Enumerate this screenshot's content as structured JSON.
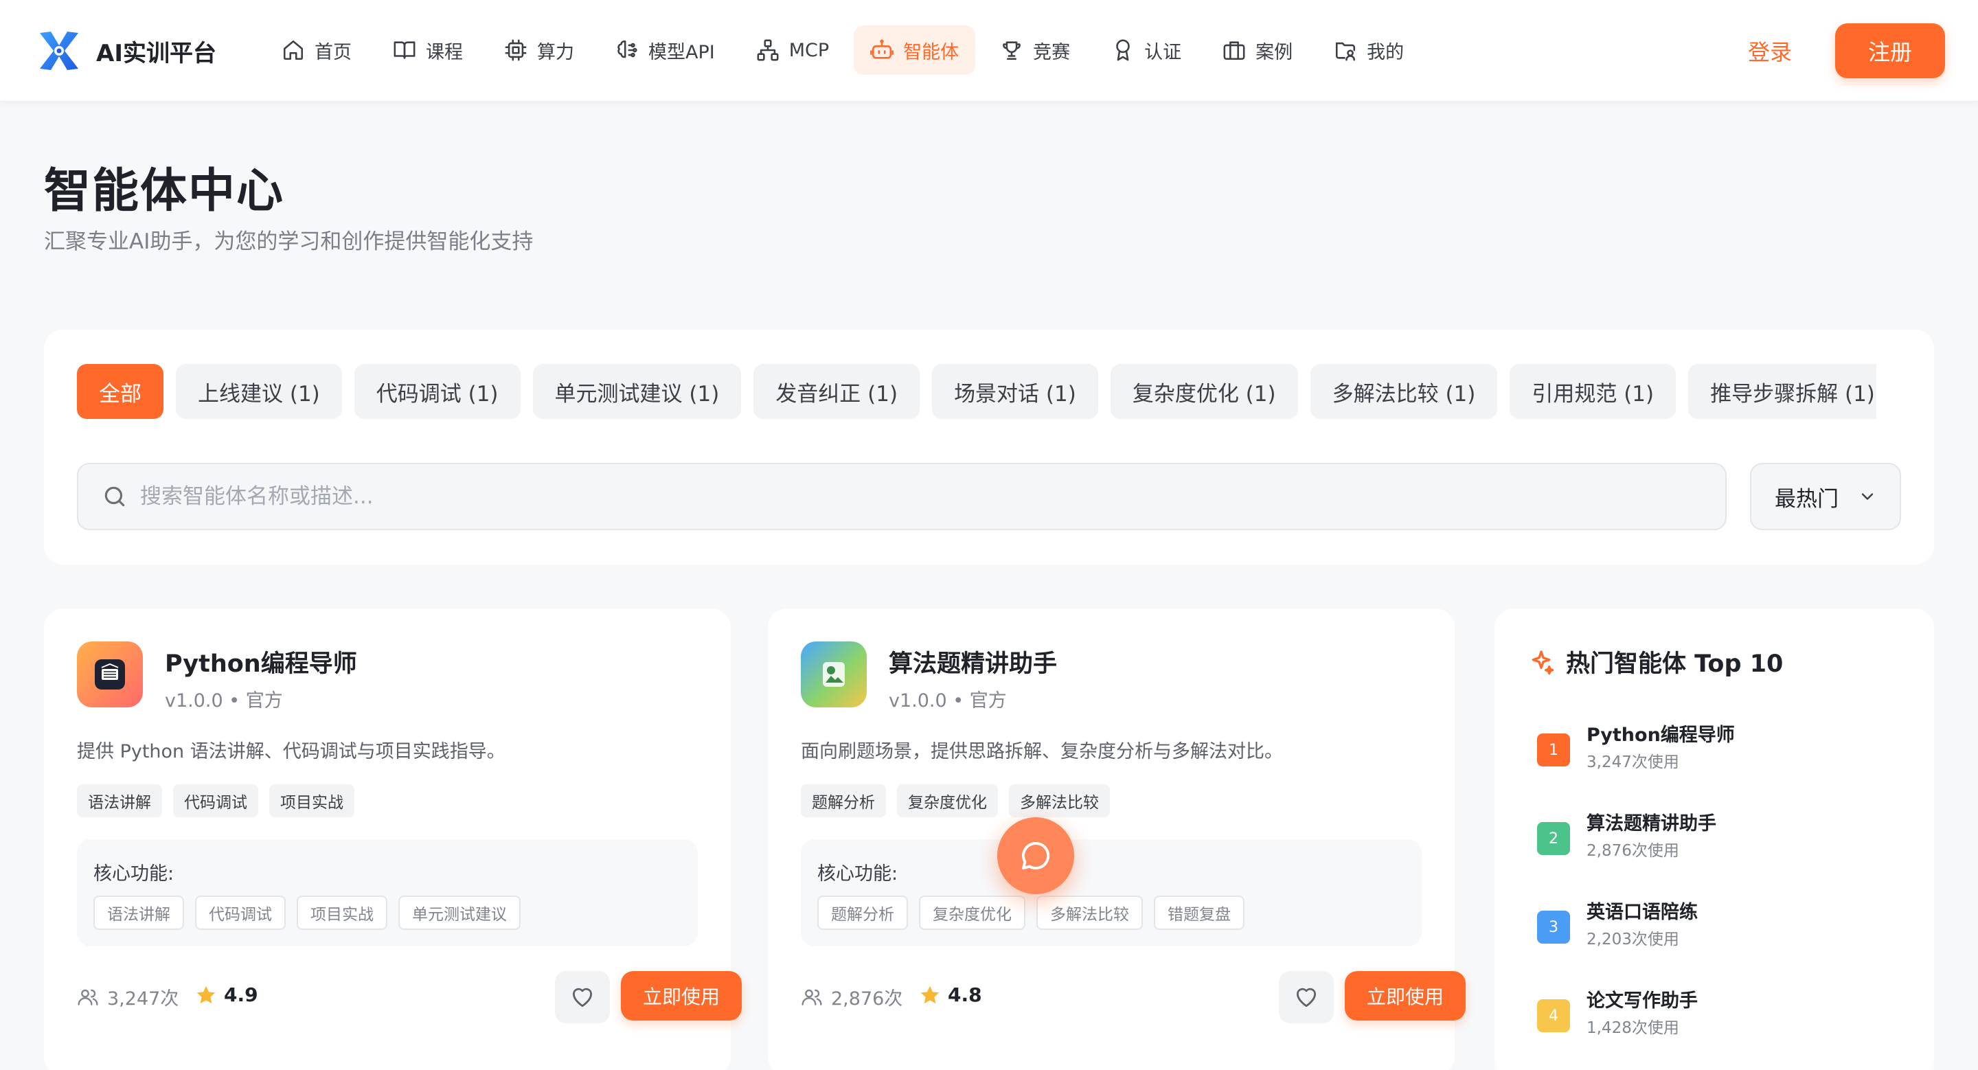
{
  "nav": {
    "brand": "AI实训平台",
    "items": [
      {
        "label": "首页",
        "icon": "home-icon"
      },
      {
        "label": "课程",
        "icon": "book-icon"
      },
      {
        "label": "算力",
        "icon": "chip-icon"
      },
      {
        "label": "模型API",
        "icon": "brain-icon"
      },
      {
        "label": "MCP",
        "icon": "network-icon"
      },
      {
        "label": "智能体",
        "icon": "robot-icon",
        "active": true
      },
      {
        "label": "竞赛",
        "icon": "trophy-icon"
      },
      {
        "label": "认证",
        "icon": "award-icon"
      },
      {
        "label": "案例",
        "icon": "briefcase-icon"
      },
      {
        "label": "我的",
        "icon": "user-folder-icon"
      }
    ],
    "login": "登录",
    "register": "注册"
  },
  "header": {
    "title": "智能体中心",
    "subtitle": "汇聚专业AI助手，为您的学习和创作提供智能化支持"
  },
  "filters": {
    "chips": [
      "全部",
      "上线建议 (1)",
      "代码调试 (1)",
      "单元测试建议 (1)",
      "发音纠正 (1)",
      "场景对话 (1)",
      "复杂度优化 (1)",
      "多解法比较 (1)",
      "引用规范 (1)",
      "推导步骤拆解 (1)",
      ""
    ],
    "search_placeholder": "搜索智能体名称或描述...",
    "sort": "最热门"
  },
  "cards": [
    {
      "title": "Python编程导师",
      "meta": "v1.0.0 • 官方",
      "desc": "提供 Python 语法讲解、代码调试与项目实践指导。",
      "tags": [
        "语法讲解",
        "代码调试",
        "项目实战"
      ],
      "features_label": "核心功能:",
      "features": [
        "语法讲解",
        "代码调试",
        "项目实战",
        "单元测试建议"
      ],
      "users": "3,247次",
      "rating": "4.9",
      "action": "立即使用"
    },
    {
      "title": "算法题精讲助手",
      "meta": "v1.0.0 • 官方",
      "desc": "面向刷题场景，提供思路拆解、复杂度分析与多解法对比。",
      "tags": [
        "题解分析",
        "复杂度优化",
        "多解法比较"
      ],
      "features_label": "核心功能:",
      "features": [
        "题解分析",
        "复杂度优化",
        "多解法比较",
        "错题复盘"
      ],
      "users": "2,876次",
      "rating": "4.8",
      "action": "立即使用"
    }
  ],
  "hot": {
    "title": "热门智能体 Top 10",
    "items": [
      {
        "rank": "1",
        "name": "Python编程导师",
        "count": "3,247次使用",
        "color": "#ff6a2b"
      },
      {
        "rank": "2",
        "name": "算法题精讲助手",
        "count": "2,876次使用",
        "color": "#4cc38a"
      },
      {
        "rank": "3",
        "name": "英语口语陪练",
        "count": "2,203次使用",
        "color": "#4b9cf5"
      },
      {
        "rank": "4",
        "name": "论文写作助手",
        "count": "1,428次使用",
        "color": "#f7c64a"
      }
    ]
  },
  "colors": {
    "accent": "#ff6a2b"
  }
}
